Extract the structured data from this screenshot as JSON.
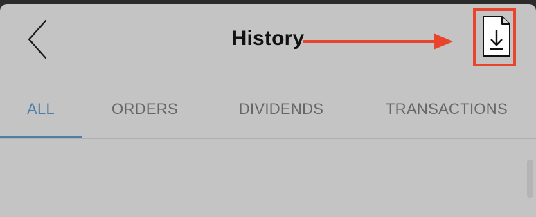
{
  "header": {
    "title": "History",
    "back_icon": "chevron-left-icon",
    "download_icon": "file-download-icon"
  },
  "annotation": {
    "color": "#e8452c"
  },
  "tabs": [
    {
      "label": "ALL",
      "active": true
    },
    {
      "label": "ORDERS",
      "active": false
    },
    {
      "label": "DIVIDENDS",
      "active": false
    },
    {
      "label": "TRANSACTIONS",
      "active": false
    }
  ],
  "colors": {
    "background": "#c4c4c4",
    "accent": "#4f7ea8",
    "tab_inactive": "#666666",
    "title": "#111111"
  }
}
